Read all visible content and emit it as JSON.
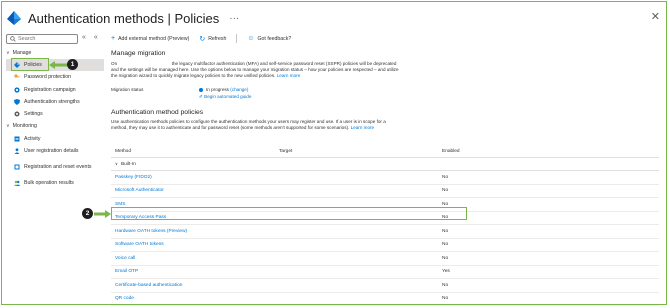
{
  "header": {
    "title": "Authentication methods | Policies",
    "more": "···",
    "close": "✕"
  },
  "sidebar": {
    "search_placeholder": "Search",
    "collapse_left": "«",
    "collapse_right": "«",
    "sections": [
      {
        "label": "Manage",
        "items": [
          {
            "label": "Policies",
            "active": true
          },
          {
            "label": "Password protection"
          },
          {
            "label": "Registration campaign"
          },
          {
            "label": "Authentication strengths"
          },
          {
            "label": "Settings"
          }
        ]
      },
      {
        "label": "Monitoring",
        "items": [
          {
            "label": "Activity"
          },
          {
            "label": "User registration details"
          },
          {
            "label": "Registration and reset events"
          },
          {
            "label": "Bulk operation results"
          }
        ]
      }
    ]
  },
  "toolbar": {
    "add_label": "Add external method (Preview)",
    "refresh_label": "Refresh",
    "feedback_label": "Got feedback?"
  },
  "migration": {
    "heading": "Manage migration",
    "text_a": "On",
    "text_b": " the legacy multifactor authentication (MFA) and self-service password reset (SSPR) policies will be deprecated and the settings will be managed here. Use the options below to manage your migration status – how your policies are respected – and utilize the migration wizard to quickly migrate legacy policies to the new unified policies.",
    "learn_more": "Learn more",
    "status_label": "Migration status",
    "status_value": "In progress",
    "change_link": "(change)",
    "begin_link": "Begin automated guide"
  },
  "policies": {
    "heading": "Authentication method policies",
    "text": "Use authentication methods policies to configure the authentication methods your users may register and use. If a user is in scope for a method, they may use it to authenticate and for password reset (some methods aren't supported for some scenarios).",
    "learn_more": "Learn more"
  },
  "table": {
    "columns": [
      "Method",
      "Target",
      "Enabled"
    ],
    "group_label": "Built-In",
    "rows": [
      {
        "method": "Passkey (FIDO2)",
        "target": "",
        "enabled": "No"
      },
      {
        "method": "Microsoft Authenticator",
        "target": "",
        "enabled": "No"
      },
      {
        "method": "SMS",
        "target": "",
        "enabled": "No"
      },
      {
        "method": "Temporary Access Pass",
        "target": "",
        "enabled": "No"
      },
      {
        "method": "Hardware OATH tokens (Preview)",
        "target": "",
        "enabled": "No"
      },
      {
        "method": "Software OATH tokens",
        "target": "",
        "enabled": "No"
      },
      {
        "method": "Voice call",
        "target": "",
        "enabled": "No"
      },
      {
        "method": "Email OTP",
        "target": "",
        "enabled": "Yes"
      },
      {
        "method": "Certificate-based authentication",
        "target": "",
        "enabled": "No"
      },
      {
        "method": "QR code",
        "target": "",
        "enabled": "No"
      }
    ]
  },
  "callouts": {
    "one": "1",
    "two": "2"
  },
  "colors": {
    "accent": "#0078d4",
    "callout": "#7ab648",
    "badge": "#1f1f1f"
  }
}
